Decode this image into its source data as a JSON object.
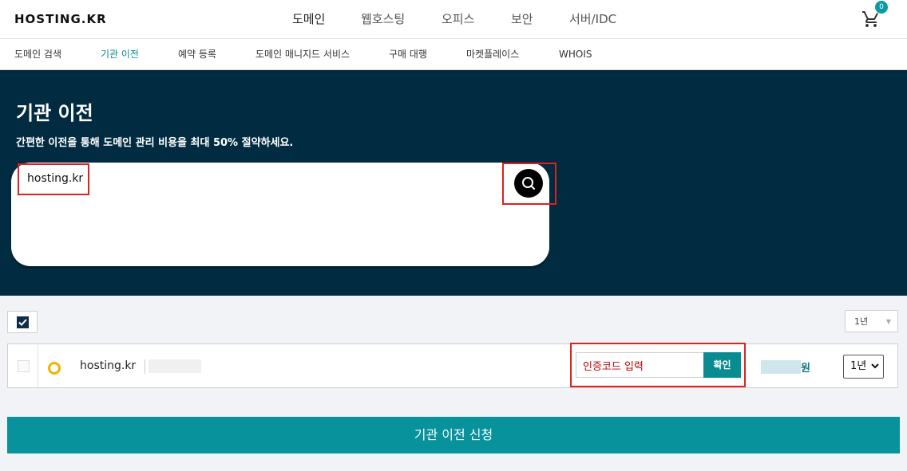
{
  "brand": {
    "logo": "HOSTING.KR",
    "accent": "#0a8b91",
    "hero_bg": "#012b40"
  },
  "main_menu": [
    "도메인",
    "웹호스팅",
    "오피스",
    "보안",
    "서버/IDC"
  ],
  "cart": {
    "count": "0",
    "icon": "cart-icon"
  },
  "sub_menu": [
    "도메인 검색",
    "기관 이전",
    "예약 등록",
    "도메인 매니지드 서비스",
    "구매 대행",
    "마켓플레이스",
    "WHOIS"
  ],
  "hero": {
    "title": "기관 이전",
    "subtitle": "간편한 이전을 통해 도메인 관리 비용을 최대 50% 절약하세요.",
    "search_value": "hosting.kr"
  },
  "list": {
    "year_all": "1년",
    "rows": [
      {
        "domain": "hosting.kr",
        "auth_placeholder": "인증코드 입력",
        "confirm_label": "확인",
        "price_unit": "원",
        "year": "1년"
      }
    ]
  },
  "submit_label": "기관 이전 신청"
}
